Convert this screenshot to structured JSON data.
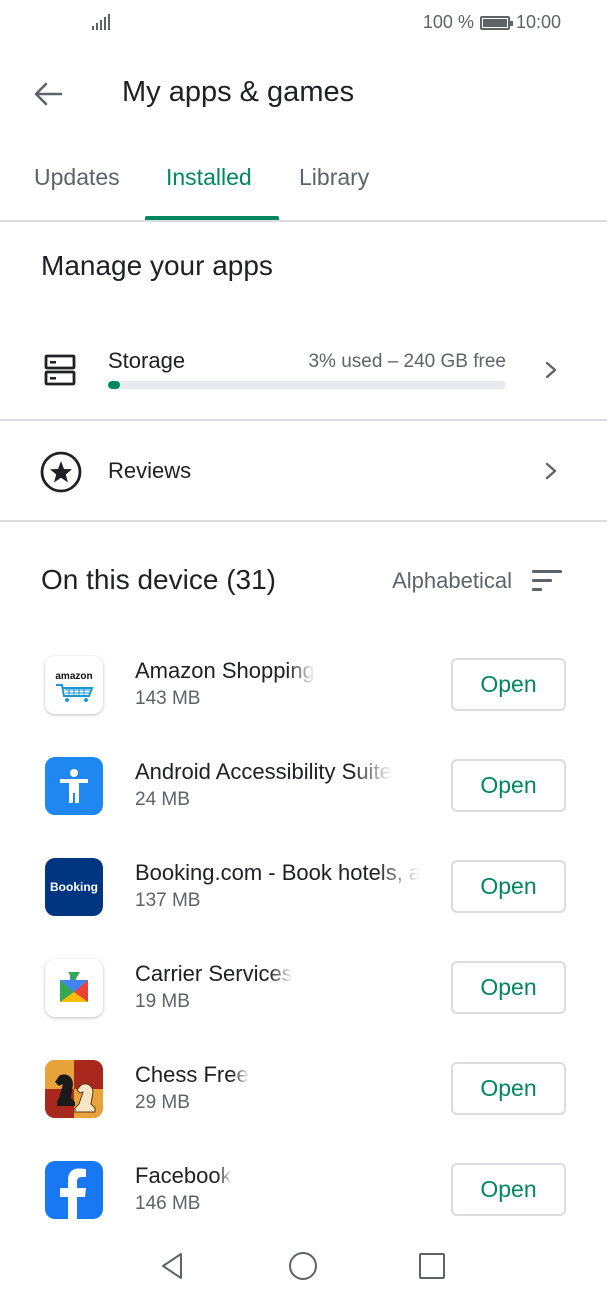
{
  "status_bar": {
    "battery_text": "100 %",
    "time": "10:00"
  },
  "header": {
    "back_icon": "arrow-back-icon",
    "title": "My apps & games"
  },
  "tabs": [
    {
      "label": "Updates",
      "active": false
    },
    {
      "label": "Installed",
      "active": true
    },
    {
      "label": "Library",
      "active": false
    }
  ],
  "manage": {
    "title": "Manage your apps",
    "storage": {
      "label": "Storage",
      "info": "3% used – 240 GB free",
      "used_fraction": 0.03,
      "icon": "storage-icon"
    },
    "reviews": {
      "label": "Reviews",
      "icon": "star-circle-icon"
    }
  },
  "device": {
    "title": "On this device (31)",
    "sort_label": "Alphabetical",
    "sort_icon": "sort-icon"
  },
  "apps": [
    {
      "name": "Amazon Shopping",
      "size": "143 MB",
      "button": "Open",
      "icon": "amazon-icon",
      "icon_text": "amazon"
    },
    {
      "name": "Android Accessibility Suite",
      "size": "24 MB",
      "button": "Open",
      "icon": "accessibility-icon"
    },
    {
      "name": "Booking.com - Book hotels, apartments & more",
      "size": "137 MB",
      "button": "Open",
      "icon": "booking-icon",
      "icon_text": "Booking"
    },
    {
      "name": "Carrier Services",
      "size": "19 MB",
      "button": "Open",
      "icon": "carrier-services-icon"
    },
    {
      "name": "Chess Free",
      "size": "29 MB",
      "button": "Open",
      "icon": "chess-icon"
    },
    {
      "name": "Facebook",
      "size": "146 MB",
      "button": "Open",
      "icon": "facebook-icon"
    }
  ],
  "colors": {
    "accent": "#01875f",
    "text_primary": "#202124",
    "text_secondary": "#5f6368",
    "divider": "#dadce0"
  }
}
